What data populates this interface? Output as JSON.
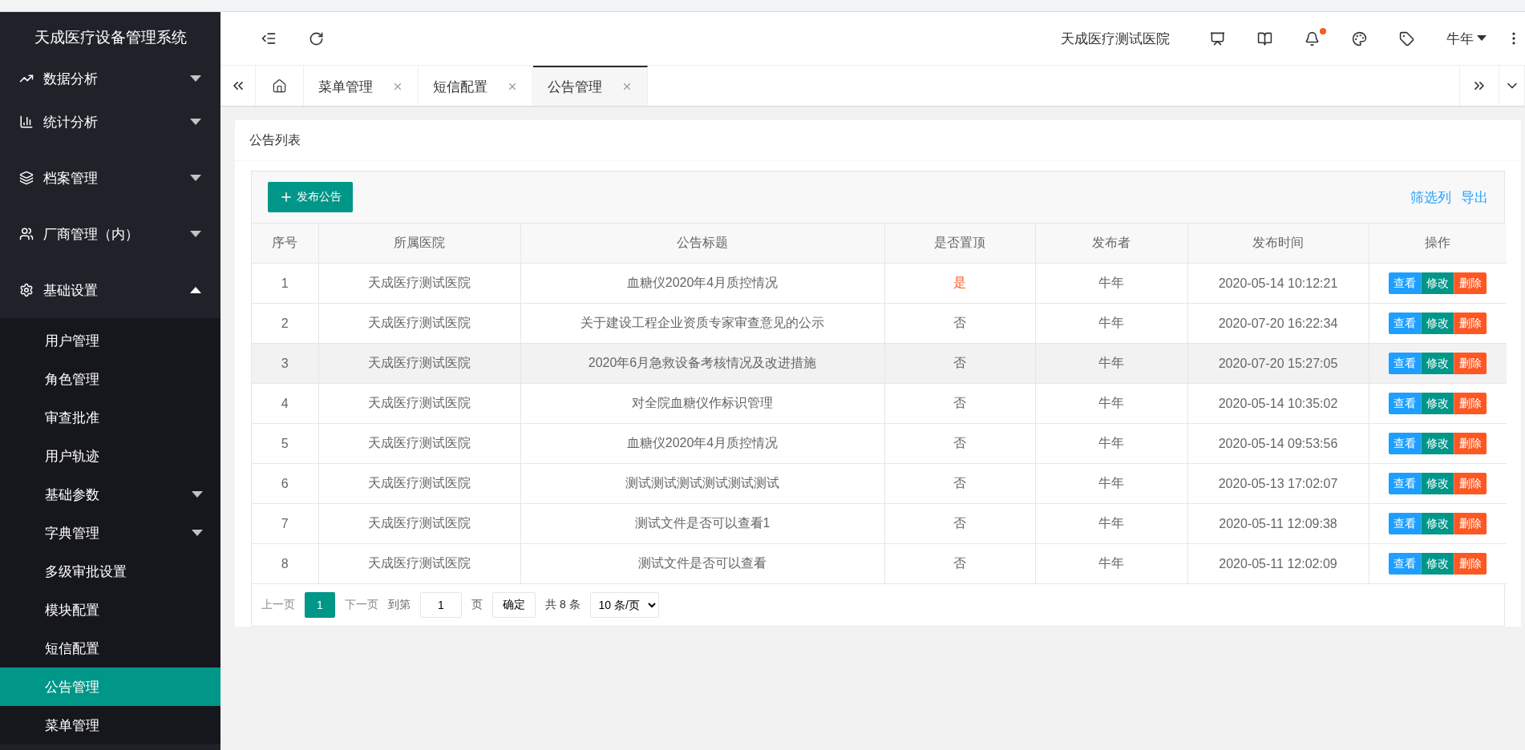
{
  "sidebar": {
    "title": "天成医疗设备管理系统",
    "items": [
      {
        "label": "数据分析",
        "expanded": false
      },
      {
        "label": "统计分析",
        "expanded": false
      },
      {
        "label": "档案管理",
        "expanded": false
      },
      {
        "label": "厂商管理（内）",
        "expanded": false
      },
      {
        "label": "基础设置",
        "expanded": true,
        "children": [
          {
            "label": "用户管理",
            "has_children": false,
            "selected": false
          },
          {
            "label": "角色管理",
            "has_children": false,
            "selected": false
          },
          {
            "label": "审查批准",
            "has_children": false,
            "selected": false
          },
          {
            "label": "用户轨迹",
            "has_children": false,
            "selected": false
          },
          {
            "label": "基础参数",
            "has_children": true,
            "selected": false
          },
          {
            "label": "字典管理",
            "has_children": true,
            "selected": false
          },
          {
            "label": "多级审批设置",
            "has_children": false,
            "selected": false
          },
          {
            "label": "模块配置",
            "has_children": false,
            "selected": false
          },
          {
            "label": "短信配置",
            "has_children": false,
            "selected": false
          },
          {
            "label": "公告管理",
            "has_children": false,
            "selected": true
          },
          {
            "label": "菜单管理",
            "has_children": false,
            "selected": false
          }
        ]
      }
    ]
  },
  "header": {
    "hospital": "天成医疗测试医院",
    "user": "牛年",
    "has_notification": true
  },
  "tabs": [
    {
      "label": "菜单管理",
      "selected": false
    },
    {
      "label": "短信配置",
      "selected": false
    },
    {
      "label": "公告管理",
      "selected": true
    }
  ],
  "card": {
    "title": "公告列表",
    "add_button": "发布公告",
    "links": [
      "筛选列",
      "导出"
    ],
    "columns": [
      "序号",
      "所属医院",
      "公告标题",
      "是否置顶",
      "发布者",
      "发布时间",
      "操作"
    ],
    "rows": [
      {
        "no": "1",
        "hospital": "天成医疗测试医院",
        "title": "血糖仪2020年4月质控情况",
        "pinned": true,
        "pinned_text": "是",
        "publisher": "牛年",
        "time": "2020-05-14 10:12:21",
        "highlighted": false,
        "actions": [
          {
            "label": "查看",
            "kind": "view"
          },
          {
            "label": "修改",
            "kind": "edit"
          },
          {
            "label": "删除",
            "kind": "delete"
          }
        ]
      },
      {
        "no": "2",
        "hospital": "天成医疗测试医院",
        "title": "关于建设工程企业资质专家审查意见的公示",
        "pinned": false,
        "pinned_text": "否",
        "publisher": "牛年",
        "time": "2020-07-20 16:22:34",
        "highlighted": false,
        "actions": [
          {
            "label": "查看",
            "kind": "view"
          },
          {
            "label": "修改",
            "kind": "edit"
          },
          {
            "label": "删除",
            "kind": "delete"
          }
        ]
      },
      {
        "no": "3",
        "hospital": "天成医疗测试医院",
        "title": "2020年6月急救设备考核情况及改进措施",
        "pinned": false,
        "pinned_text": "否",
        "publisher": "牛年",
        "time": "2020-07-20 15:27:05",
        "highlighted": true,
        "actions": [
          {
            "label": "查看",
            "kind": "view"
          },
          {
            "label": "修改",
            "kind": "edit"
          },
          {
            "label": "删除",
            "kind": "delete"
          }
        ]
      },
      {
        "no": "4",
        "hospital": "天成医疗测试医院",
        "title": "对全院血糖仪作标识管理",
        "pinned": false,
        "pinned_text": "否",
        "publisher": "牛年",
        "time": "2020-05-14 10:35:02",
        "highlighted": false,
        "actions": [
          {
            "label": "查看",
            "kind": "view"
          },
          {
            "label": "修改",
            "kind": "edit"
          },
          {
            "label": "删除",
            "kind": "delete"
          }
        ]
      },
      {
        "no": "5",
        "hospital": "天成医疗测试医院",
        "title": "血糖仪2020年4月质控情况",
        "pinned": false,
        "pinned_text": "否",
        "publisher": "牛年",
        "time": "2020-05-14 09:53:56",
        "highlighted": false,
        "actions": [
          {
            "label": "查看",
            "kind": "view"
          },
          {
            "label": "修改",
            "kind": "edit"
          },
          {
            "label": "删除",
            "kind": "delete"
          }
        ]
      },
      {
        "no": "6",
        "hospital": "天成医疗测试医院",
        "title": "测试测试测试测试测试测试",
        "pinned": false,
        "pinned_text": "否",
        "publisher": "牛年",
        "time": "2020-05-13 17:02:07",
        "highlighted": false,
        "actions": [
          {
            "label": "查看",
            "kind": "view"
          },
          {
            "label": "修改",
            "kind": "edit"
          },
          {
            "label": "删除",
            "kind": "delete"
          }
        ]
      },
      {
        "no": "7",
        "hospital": "天成医疗测试医院",
        "title": "测试文件是否可以查看1",
        "pinned": false,
        "pinned_text": "否",
        "publisher": "牛年",
        "time": "2020-05-11 12:09:38",
        "highlighted": false,
        "actions": [
          {
            "label": "查看",
            "kind": "view"
          },
          {
            "label": "修改",
            "kind": "edit"
          },
          {
            "label": "删除",
            "kind": "delete"
          }
        ]
      },
      {
        "no": "8",
        "hospital": "天成医疗测试医院",
        "title": "测试文件是否可以查看",
        "pinned": false,
        "pinned_text": "否",
        "publisher": "牛年",
        "time": "2020-05-11 12:02:09",
        "highlighted": false,
        "actions": [
          {
            "label": "查看",
            "kind": "view"
          },
          {
            "label": "修改",
            "kind": "edit"
          },
          {
            "label": "删除",
            "kind": "delete"
          }
        ]
      }
    ],
    "pagination": {
      "prev": {
        "label": "上一页",
        "disabled": true
      },
      "pages": [
        {
          "label": "1",
          "selected": true
        }
      ],
      "next": {
        "label": "下一页",
        "disabled": true
      },
      "goto_label": "到第",
      "goto_value": "1",
      "page_unit": "页",
      "confirm": "确定",
      "total": "共 8 条",
      "page_size": "10 条/页"
    }
  }
}
